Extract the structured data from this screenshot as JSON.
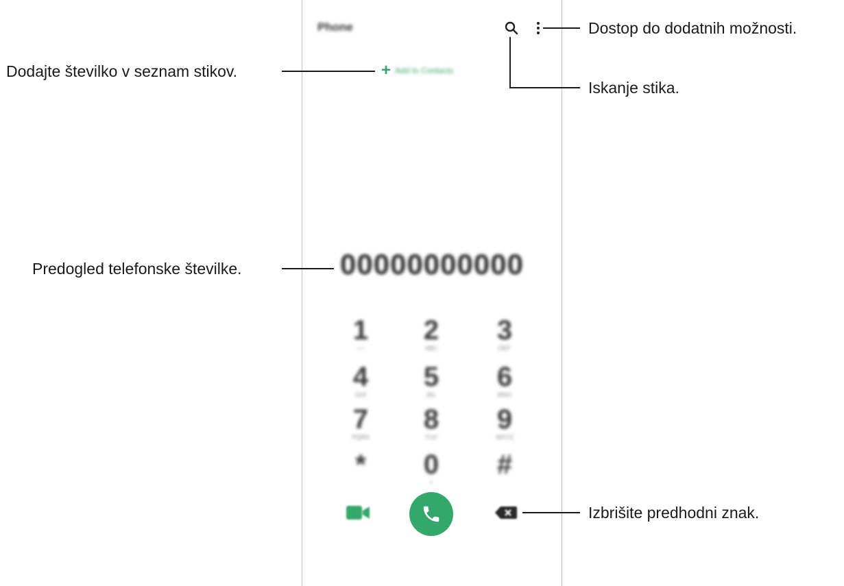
{
  "phone": {
    "title": "Phone",
    "add_to_contacts": "Add to Contacts",
    "number_preview": "00000000000",
    "keys": [
      {
        "digit": "1",
        "sub": "○○"
      },
      {
        "digit": "2",
        "sub": "ABC"
      },
      {
        "digit": "3",
        "sub": "DEF"
      },
      {
        "digit": "4",
        "sub": "GHI"
      },
      {
        "digit": "5",
        "sub": "JKL"
      },
      {
        "digit": "6",
        "sub": "MNO"
      },
      {
        "digit": "7",
        "sub": "PQRS"
      },
      {
        "digit": "8",
        "sub": "TUV"
      },
      {
        "digit": "9",
        "sub": "WXYZ"
      },
      {
        "digit": "*",
        "sub": ""
      },
      {
        "digit": "0",
        "sub": "+"
      },
      {
        "digit": "#",
        "sub": ""
      }
    ],
    "accent_color": "#34a86a"
  },
  "callouts": {
    "more_options": "Dostop do dodatnih možnosti.",
    "add_contact": "Dodajte številko v seznam stikov.",
    "search": "Iskanje stika.",
    "number_preview": "Predogled telefonske številke.",
    "delete": "Izbrišite predhodni znak."
  }
}
